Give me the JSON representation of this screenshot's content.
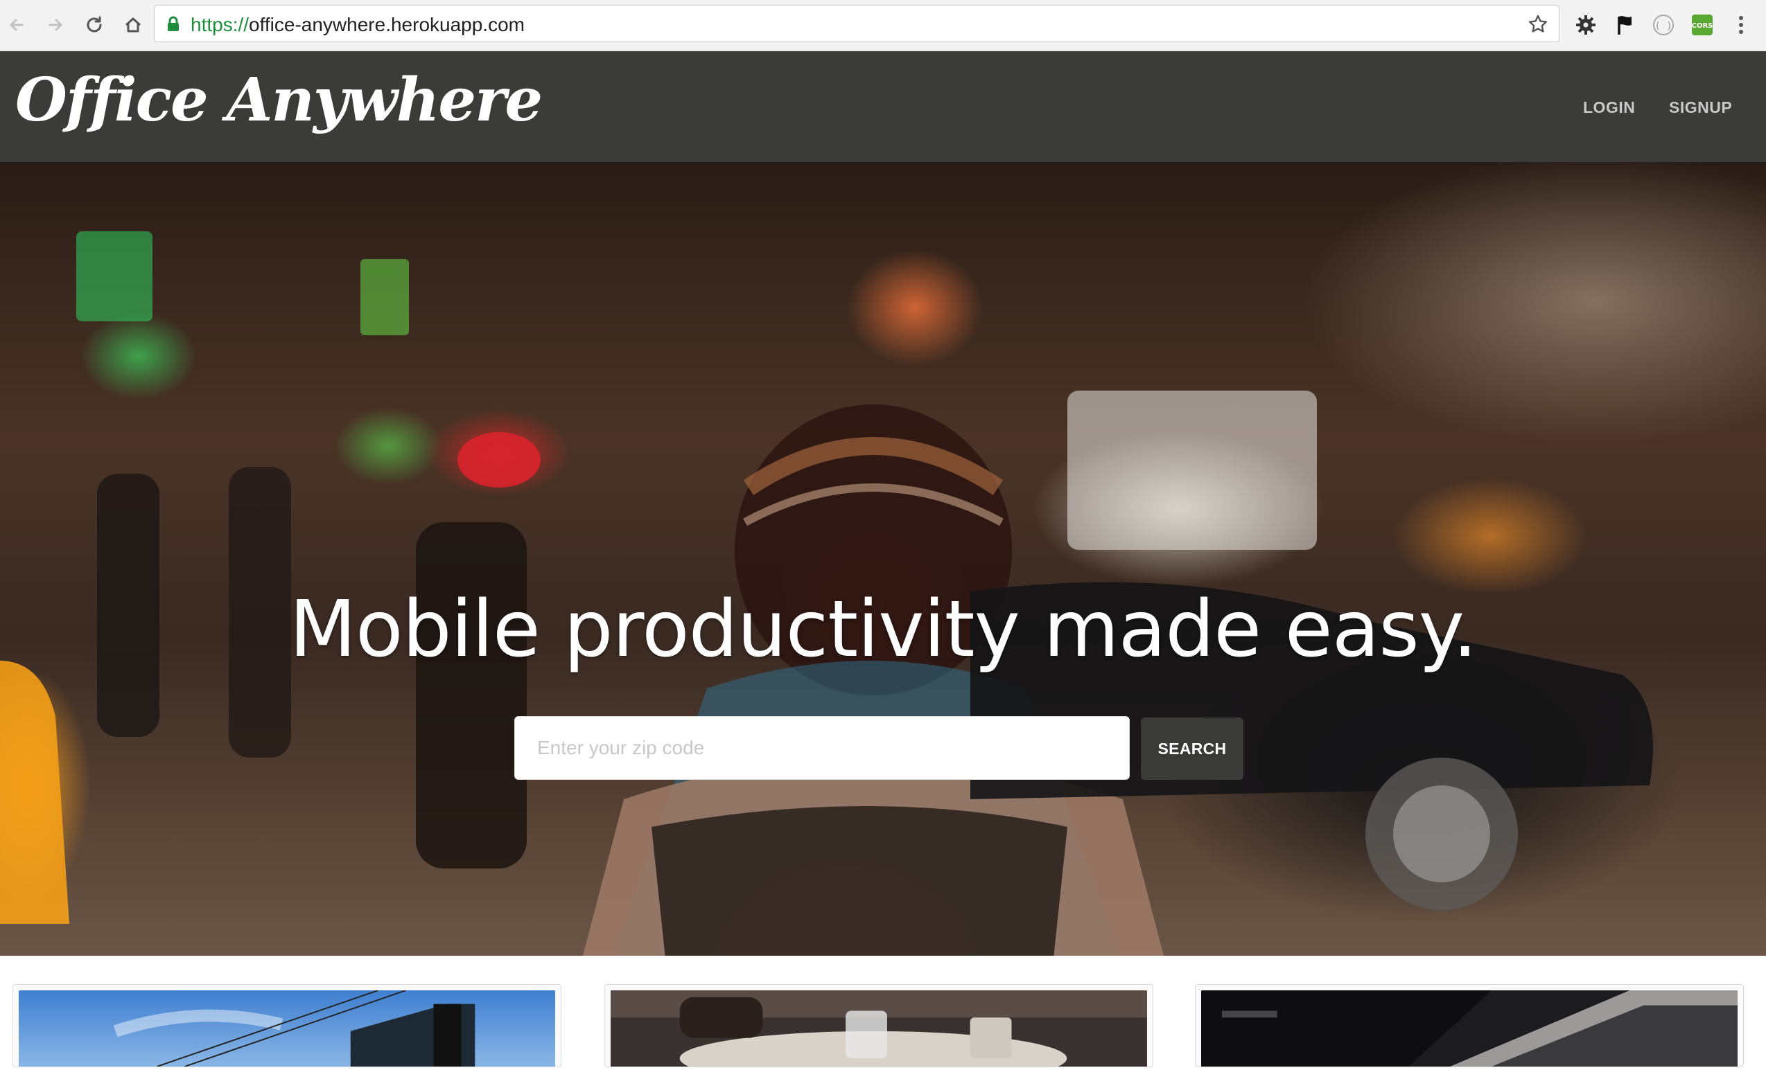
{
  "browser": {
    "url_scheme": "https://",
    "url_host": "office-anywhere.herokuapp.com"
  },
  "site": {
    "brand": "Office Anywhere",
    "nav": {
      "login": "LOGIN",
      "signup": "SIGNUP"
    }
  },
  "hero": {
    "headline": "Mobile productivity made easy.",
    "zip_placeholder": "Enter your zip code",
    "zip_value": "",
    "search_label": "SEARCH"
  },
  "cards": [
    {
      "image": "building-photo"
    },
    {
      "image": "cafe-table-photo"
    },
    {
      "image": "laptop-photo"
    }
  ],
  "colors": {
    "navbar": "#3b3c3a",
    "button": "#3a3b39",
    "secure": "#1e8e3e"
  }
}
